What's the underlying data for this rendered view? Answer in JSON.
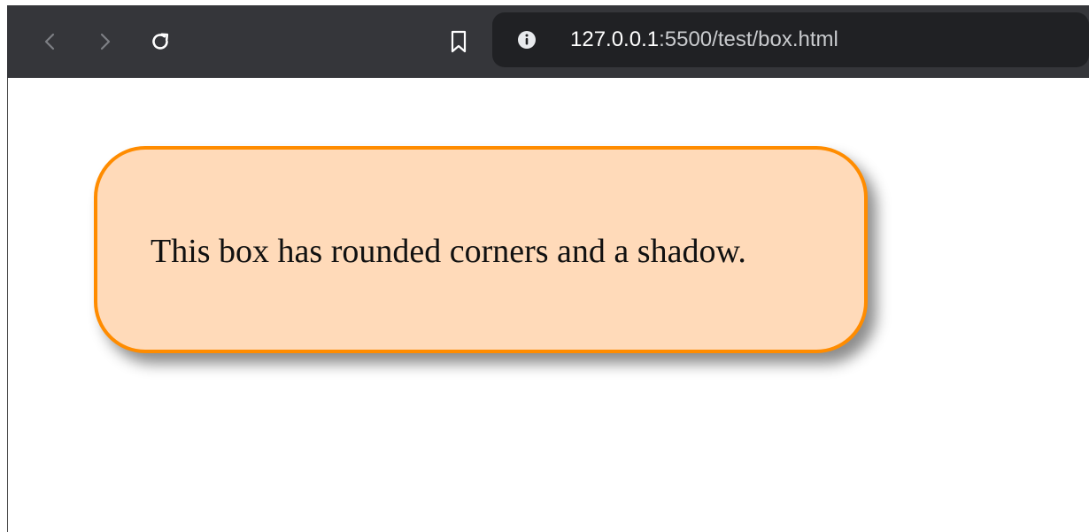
{
  "browser": {
    "back_icon": "chevron-left-icon",
    "forward_icon": "chevron-right-icon",
    "reload_icon": "reload-icon",
    "bookmark_icon": "bookmark-icon",
    "site_info_icon": "info-icon",
    "url_host": "127.0.0.1",
    "url_rest": ":5500/test/box.html",
    "toolbar_color": "#35363a",
    "omnibox_color": "#202124"
  },
  "page": {
    "box_text": "This box has rounded corners and a shadow.",
    "box_background": "#ffdab9",
    "box_border": "#ff8c00"
  }
}
